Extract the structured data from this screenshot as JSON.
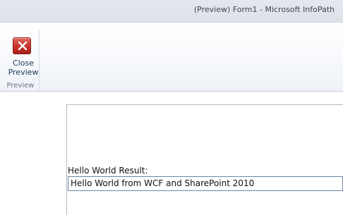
{
  "window": {
    "title": "(Preview) Form1  -  Microsoft InfoPath"
  },
  "ribbon": {
    "group_label": "Preview",
    "close_preview": {
      "label_line1": "Close",
      "label_line2": "Preview",
      "icon": "close-icon"
    }
  },
  "form": {
    "field_label": "Hello World Result:",
    "field_value": "Hello World from WCF and SharePoint 2010"
  },
  "colors": {
    "close_icon": "#c8302a",
    "field_border": "#6f86a6"
  }
}
